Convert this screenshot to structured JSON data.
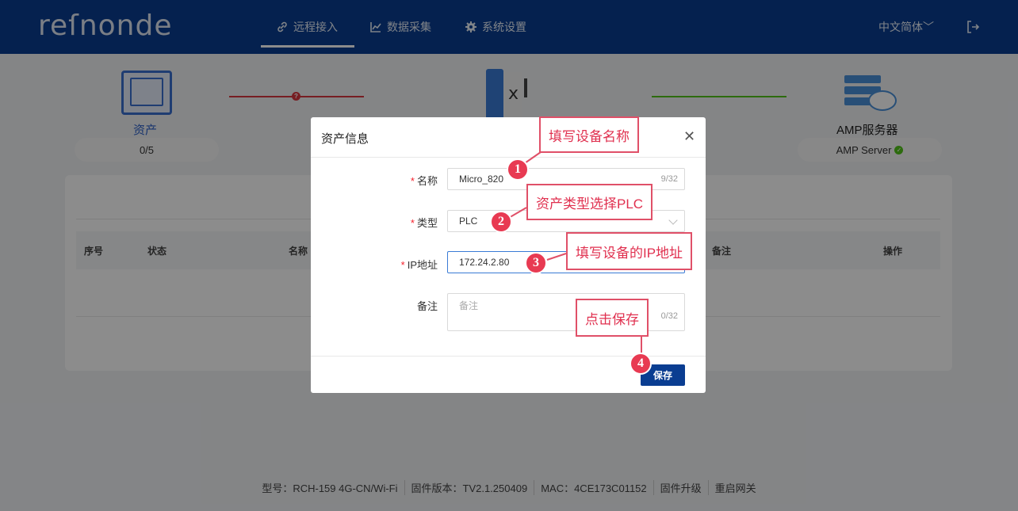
{
  "header": {
    "logo": "reſnonde",
    "nav": [
      {
        "label": "远程接入",
        "icon": "link-icon",
        "active": true
      },
      {
        "label": "数据采集",
        "icon": "chart-icon",
        "active": false
      },
      {
        "label": "系统设置",
        "icon": "gear-icon",
        "active": false
      }
    ],
    "language": "中文简体",
    "logout_icon": "logout-icon"
  },
  "topology": {
    "asset_label": "资产",
    "asset_count": "0/5",
    "server_label": "AMP服务器",
    "server_status": "AMP Server",
    "asset_link_status_icon": "error-icon",
    "server_link_status_icon": "success-check-icon"
  },
  "table": {
    "columns": [
      "序号",
      "状态",
      "名称",
      "备注",
      "操作"
    ]
  },
  "footer": {
    "model": "型号：RCH-159  4G-CN/Wi-Fi",
    "firmware": "固件版本：TV2.1.250409",
    "mac": "MAC：4CE173C01152",
    "upgrade": "固件升级",
    "reboot": "重启网关"
  },
  "modal": {
    "title": "资产信息",
    "close_icon": "close-icon",
    "fields": {
      "name": {
        "label": "名称",
        "required": true,
        "value": "Micro_820",
        "count": "9/32"
      },
      "type": {
        "label": "类型",
        "required": true,
        "value": "PLC"
      },
      "ip": {
        "label": "IP地址",
        "required": true,
        "value": "172.24.2.80"
      },
      "note": {
        "label": "备注",
        "required": false,
        "placeholder": "备注",
        "count": "0/32"
      }
    },
    "save_label": "保存"
  },
  "annotations": [
    {
      "num": "1",
      "text": "填写设备名称"
    },
    {
      "num": "2",
      "text": "资产类型选择PLC"
    },
    {
      "num": "3",
      "text": "填写设备的IP地址"
    },
    {
      "num": "4",
      "text": "点击保存"
    }
  ],
  "colors": {
    "brand": "#0a3d91",
    "accent": "#e0304f",
    "error": "#d9363e",
    "success": "#52c41a"
  }
}
